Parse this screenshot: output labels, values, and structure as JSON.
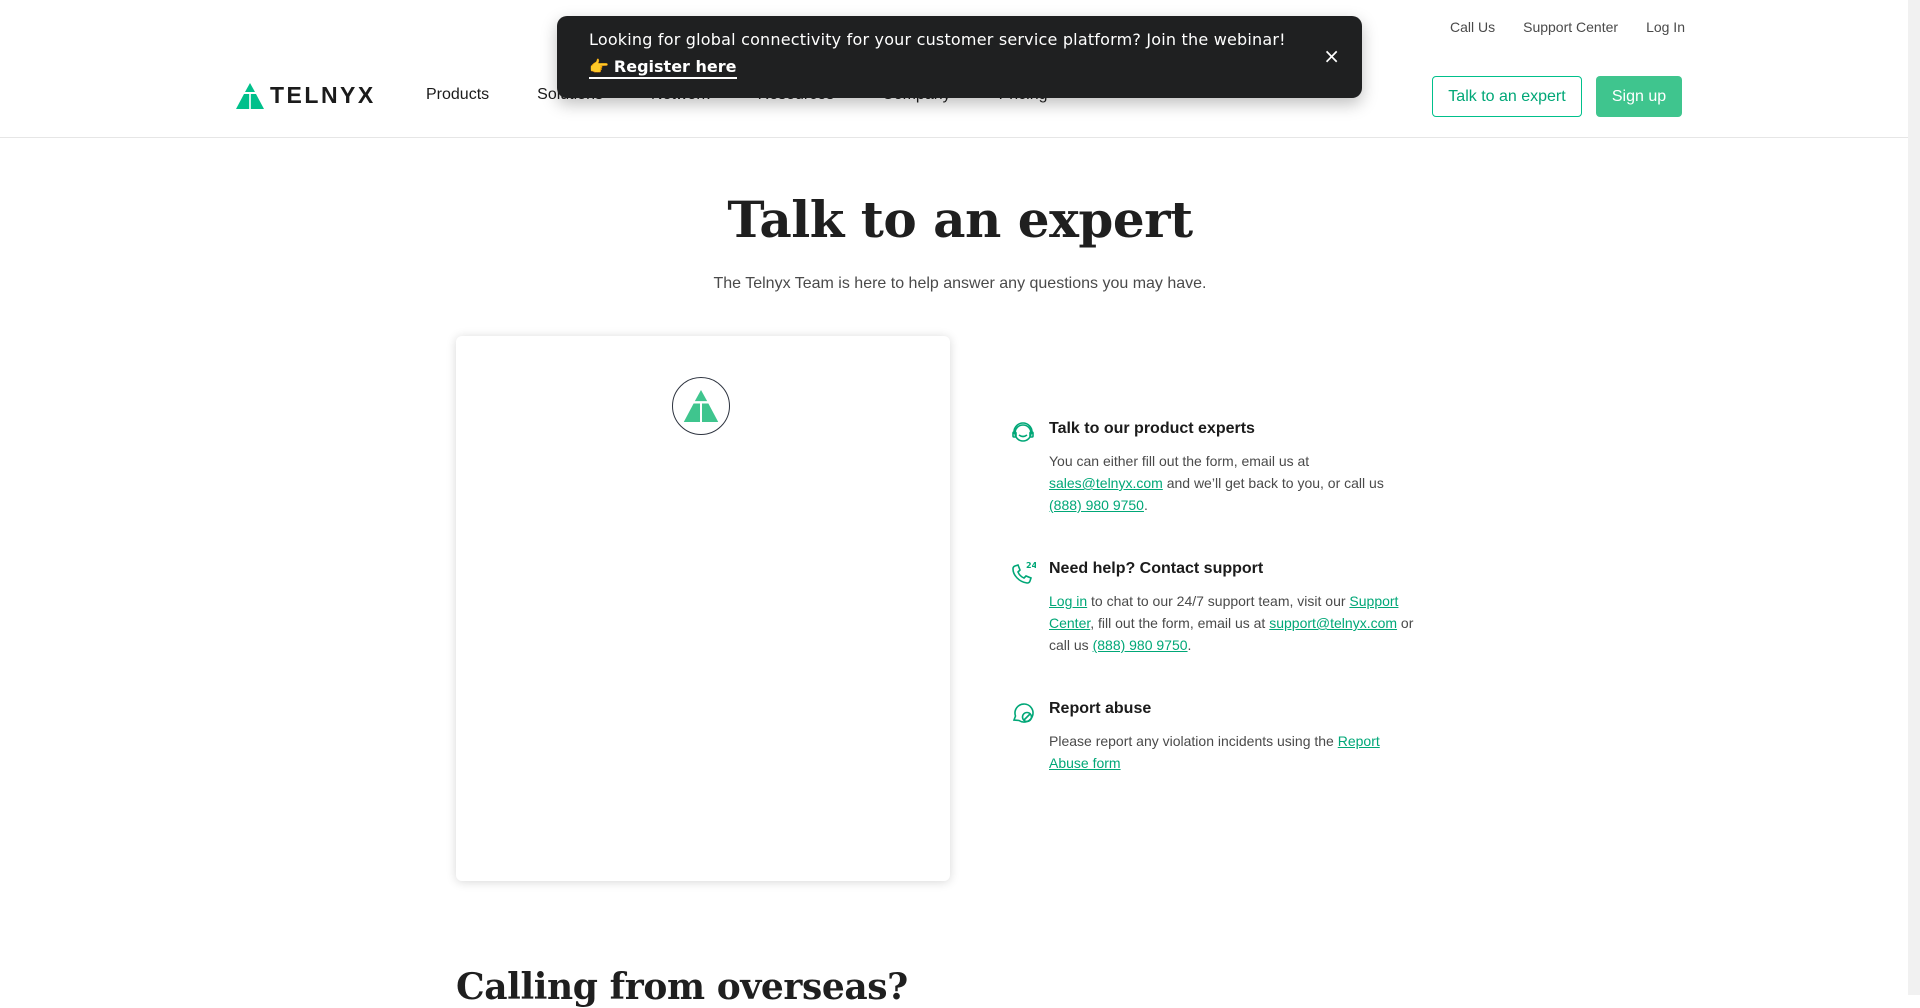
{
  "utility_nav": [
    "Call Us",
    "Support Center",
    "Log In"
  ],
  "logo": {
    "text": "TELNYX"
  },
  "nav": [
    "Products",
    "Solutions",
    "Network",
    "Resources",
    "Company",
    "Pricing"
  ],
  "header_buttons": {
    "talk": "Talk to an expert",
    "signup": "Sign up"
  },
  "banner": {
    "text": "Looking for global connectivity for your customer service platform? Join the webinar!",
    "link_emoji": "👉",
    "link": "Register here",
    "close": "×"
  },
  "hero": {
    "title": "Talk to an expert",
    "subtitle": "The Telnyx Team is here to help answer any questions you may have."
  },
  "contact": {
    "experts": {
      "title": "Talk to our product experts",
      "t1": "You can either fill out the form, email us at ",
      "email": "sales@telnyx.com",
      "t2": " and we’ll get back to you, or call us ",
      "phone": "(888) 980 9750",
      "t3": "."
    },
    "support": {
      "title": "Need help? Contact support",
      "login": "Log in",
      "t1": " to chat to our 24/7 support team, visit our ",
      "center": "Support Center",
      "t2": ", fill out the form, email us at ",
      "email": "support@telnyx.com",
      "t3": " or call us ",
      "phone": "(888) 980 9750",
      "t4": "."
    },
    "abuse": {
      "title": "Report abuse",
      "t1": "Please report any violation incidents using the ",
      "link": "Report Abuse form"
    }
  },
  "overseas": {
    "title": "Calling from overseas?"
  },
  "colors": {
    "brand": "#00c08b",
    "button": "#3fc58e",
    "link": "#00a777",
    "banner": "#1f2021"
  },
  "icons": [
    "telnyx-logo-icon",
    "headset-icon",
    "phone-24-icon",
    "chat-shield-icon",
    "close-icon",
    "pointing-hand-icon"
  ]
}
